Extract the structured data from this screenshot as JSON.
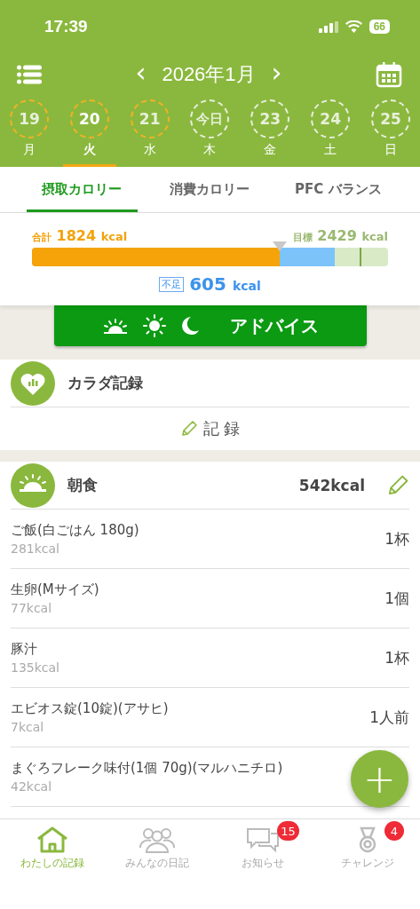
{
  "status_bar": {
    "time": "17:39",
    "battery": "66"
  },
  "header": {
    "month": "2026年1月",
    "prev": "‹",
    "next": "›"
  },
  "days": [
    {
      "number": "19",
      "weekday": "月",
      "recorded": true,
      "selected": false
    },
    {
      "number": "20",
      "weekday": "火",
      "recorded": true,
      "selected": true
    },
    {
      "number": "21",
      "weekday": "水",
      "recorded": true,
      "selected": false
    },
    {
      "number": "今日",
      "weekday": "木",
      "recorded": false,
      "selected": false
    },
    {
      "number": "23",
      "weekday": "金",
      "recorded": false,
      "selected": false
    },
    {
      "number": "24",
      "weekday": "土",
      "recorded": false,
      "selected": false
    },
    {
      "number": "25",
      "weekday": "日",
      "recorded": false,
      "selected": false
    }
  ],
  "tabs": [
    {
      "label": "摂取カロリー",
      "selected": true
    },
    {
      "label": "消費カロリー",
      "selected": false
    },
    {
      "label": "PFC バランス",
      "selected": false
    }
  ],
  "summary": {
    "total_label": "合計",
    "total": "1824",
    "total_unit": "kcal",
    "goal_label": "目標",
    "goal": "2429",
    "goal_unit": "kcal",
    "intake": {
      "level": 0.695
    },
    "shortfall_label": "不足",
    "shortfall": "605",
    "shortfall_unit": "kcal"
  },
  "advice_button": "アドバイス",
  "body_record": {
    "title": "カラダ記録",
    "action": "記 録"
  },
  "meal": {
    "title": "朝食",
    "total": "542kcal",
    "items": [
      {
        "name": "ご飯(白ごはん 180g)",
        "kcal": "281kcal",
        "amount": "1杯"
      },
      {
        "name": "生卵(Mサイズ)",
        "kcal": "77kcal",
        "amount": "1個"
      },
      {
        "name": "豚汁",
        "kcal": "135kcal",
        "amount": "1杯"
      },
      {
        "name": "エビオス錠(10錠)(アサヒ)",
        "kcal": "7kcal",
        "amount": "1人前"
      },
      {
        "name": "まぐろフレーク味付(1個 70g)(マルハニチロ)",
        "kcal": "42kcal"
      }
    ]
  },
  "add_button": "+",
  "nav": [
    {
      "kind": "home",
      "label": "わたしの記録",
      "selected": true
    },
    {
      "kind": "people",
      "label": "みんなの日記",
      "selected": false
    },
    {
      "kind": "chat",
      "label": "お知らせ",
      "selected": false,
      "badge": "15"
    },
    {
      "kind": "medal",
      "label": "チャレンジ",
      "selected": false,
      "badge": "4"
    }
  ]
}
